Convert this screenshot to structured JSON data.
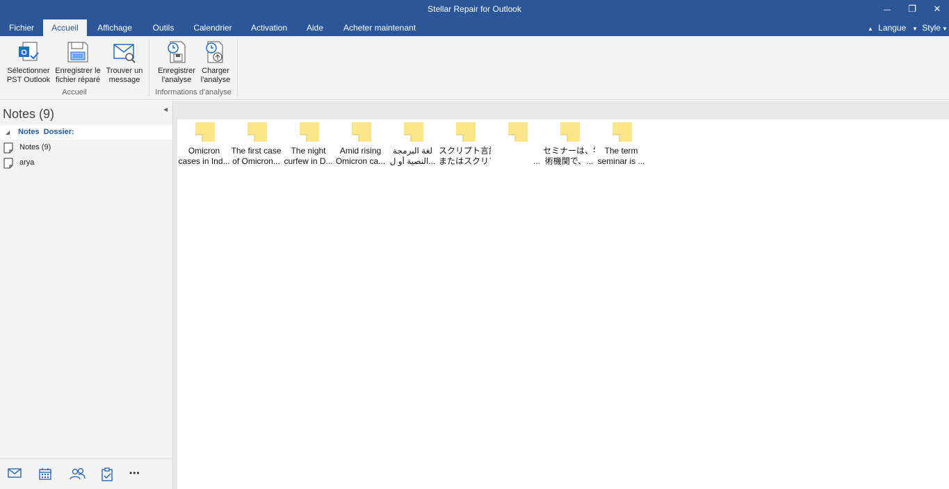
{
  "window": {
    "title": "Stellar Repair for Outlook",
    "minimize_label": "—",
    "restore_label": "❐",
    "close_label": "✕"
  },
  "menu": {
    "tabs": [
      {
        "label": "Fichier"
      },
      {
        "label": "Accueil"
      },
      {
        "label": "Affichage"
      },
      {
        "label": "Outils"
      },
      {
        "label": "Calendrier"
      },
      {
        "label": "Activation"
      },
      {
        "label": "Aide"
      },
      {
        "label": "Acheter maintenant"
      }
    ],
    "active_tab": "Accueil",
    "language_label": "Langue",
    "style_label": "Style"
  },
  "ribbon": {
    "groups": [
      {
        "label": "Accueil",
        "buttons": [
          {
            "line1": "Sélectionner",
            "line2": "PST Outlook",
            "icon": "outlook-pst-icon"
          },
          {
            "line1": "Enregistrer le",
            "line2": "fichier réparé",
            "icon": "save-icon"
          },
          {
            "line1": "Trouver un",
            "line2": "message",
            "icon": "find-message-icon"
          }
        ]
      },
      {
        "label": "Informations d'analyse",
        "buttons": [
          {
            "line1": "Enregistrer",
            "line2": "l'analyse",
            "icon": "save-scan-icon"
          },
          {
            "line1": "Charger",
            "line2": "l'analyse",
            "icon": "load-scan-icon"
          }
        ]
      }
    ]
  },
  "left_pane": {
    "title": "Notes (9)",
    "tree_header": "Notes  Dossier:",
    "items": [
      {
        "label": "Notes (9)"
      },
      {
        "label": "arya"
      }
    ],
    "nav": [
      "mail-icon",
      "calendar-icon",
      "contacts-icon",
      "tasks-icon",
      "more-icon"
    ],
    "more_label": "•••"
  },
  "notes": [
    {
      "line1": "Omicron",
      "line2": "cases in Ind..."
    },
    {
      "line1": "The first case",
      "line2": "of Omicron..."
    },
    {
      "line1": "The night",
      "line2": "curfew in D..."
    },
    {
      "line1": "Amid rising",
      "line2": "Omicron ca..."
    },
    {
      "line1": "لغة البرمجة",
      "line2": "...النصية أو ل"
    },
    {
      "line1": "スクリプト言語",
      "line2": "またはスクリプ..."
    },
    {
      "line1": "",
      "line2": "..."
    },
    {
      "line1": "セミナーは、学",
      "line2": "術機関で、..."
    },
    {
      "line1": "The term",
      "line2": "seminar is ..."
    }
  ],
  "colors": {
    "accent": "#2b579a",
    "note_yellow": "#fde58a",
    "folder_blue": "#1e5aa8"
  }
}
